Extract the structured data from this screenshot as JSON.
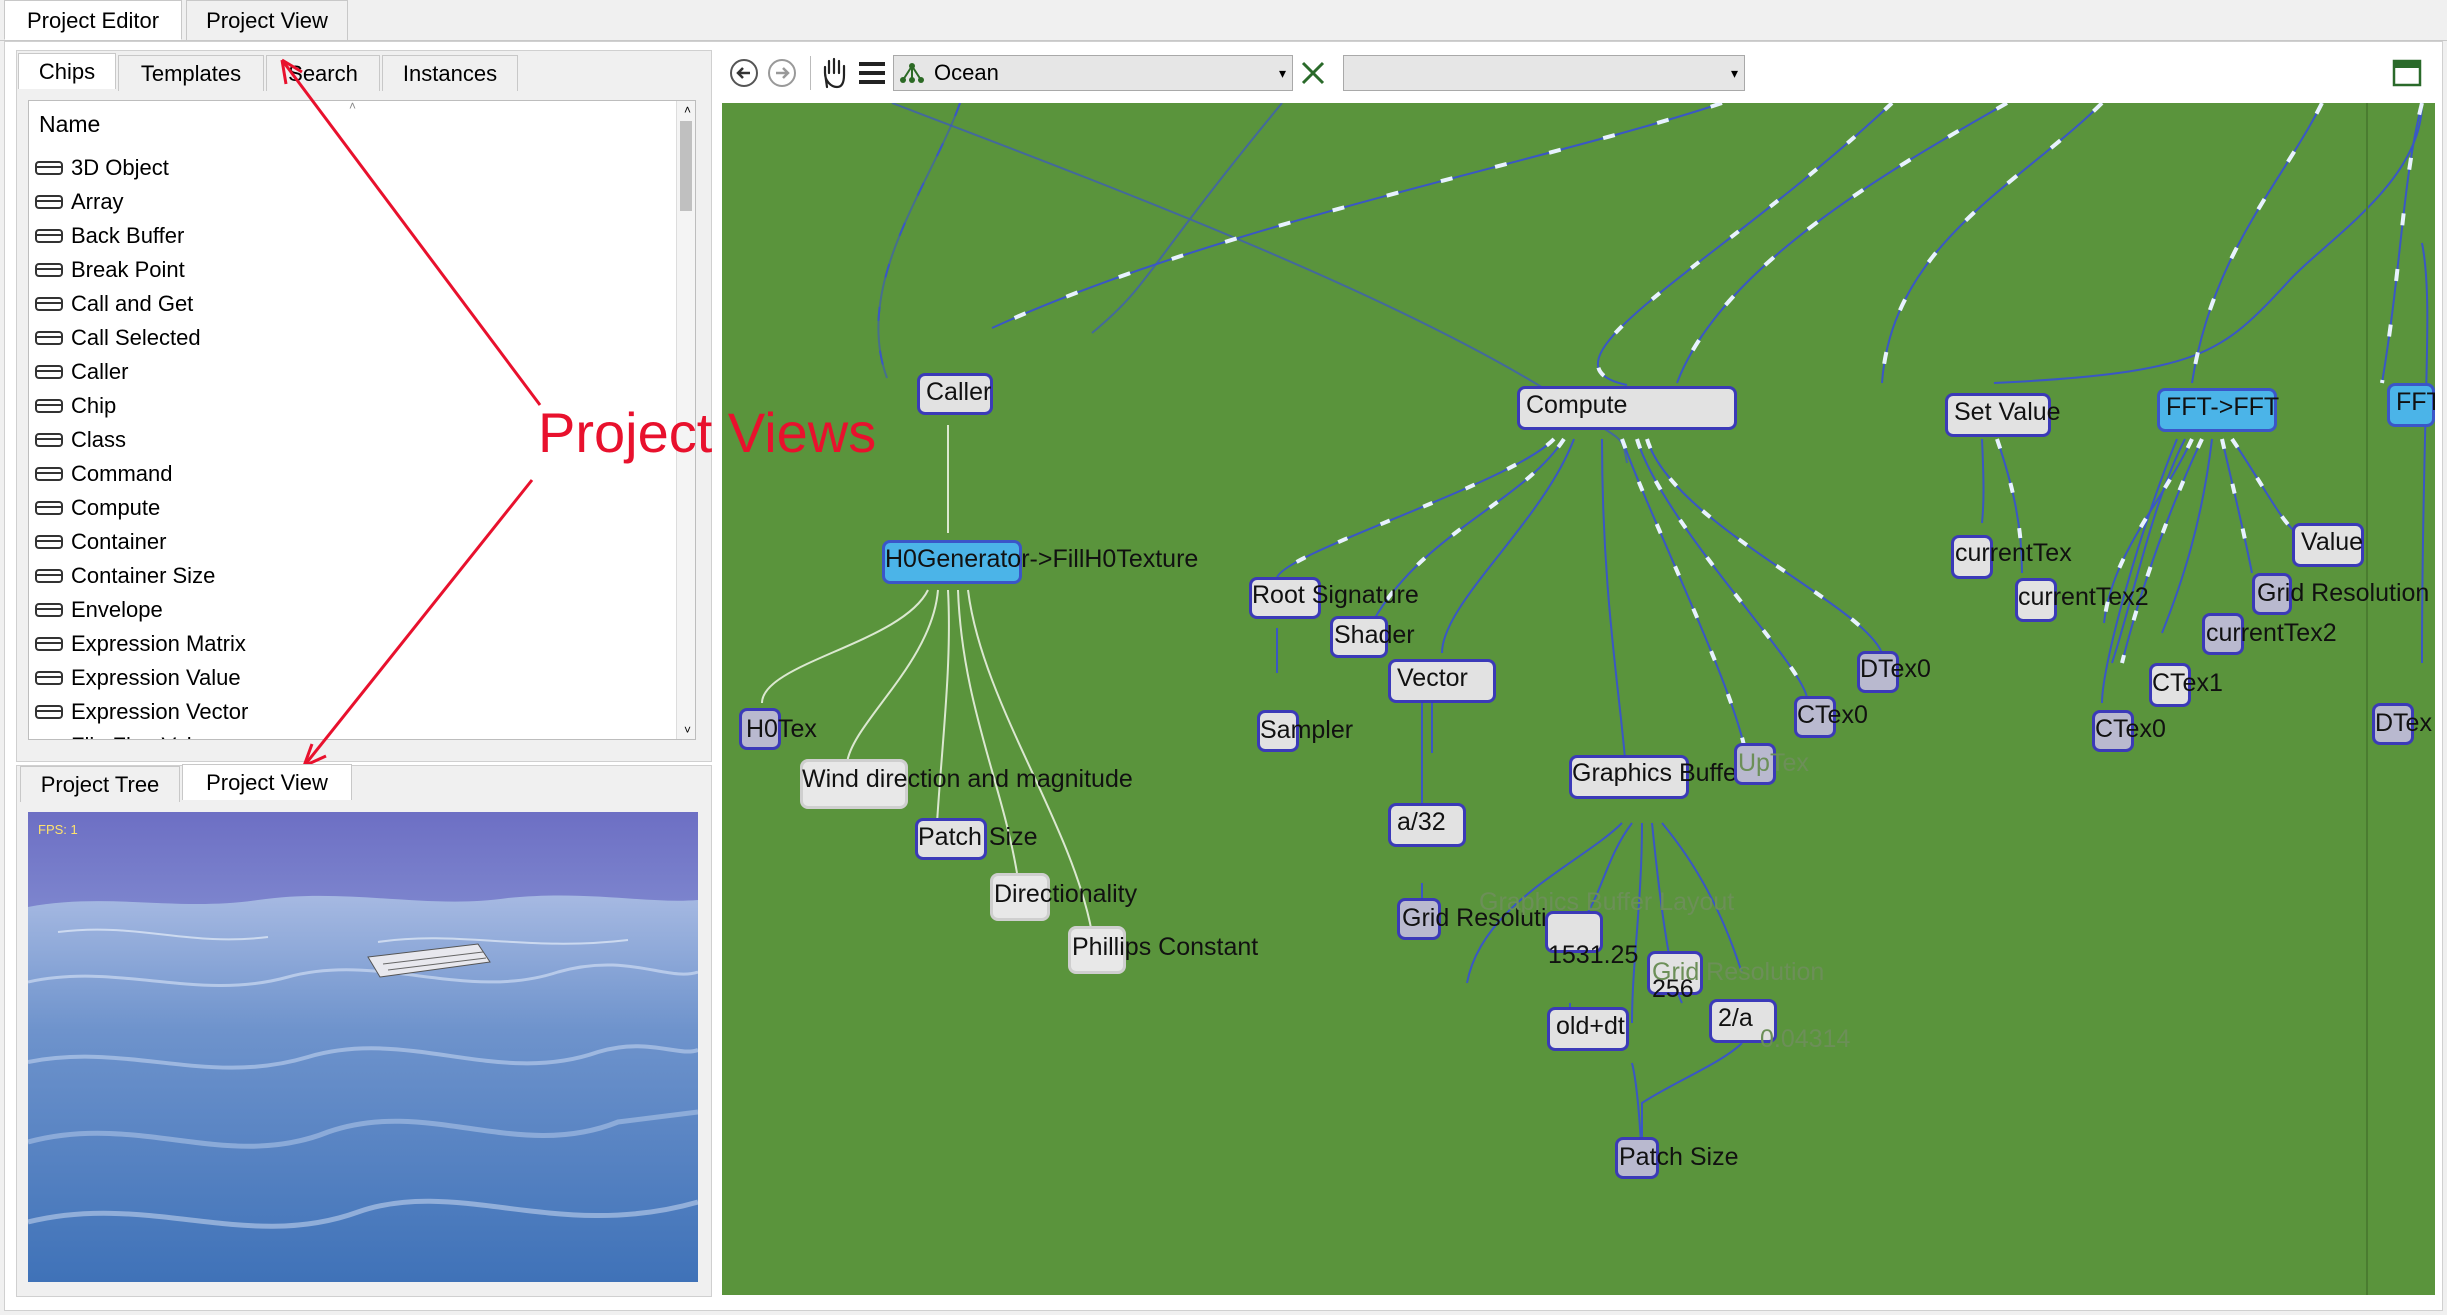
{
  "top_tabs": [
    "Project Editor",
    "Project View"
  ],
  "left_tabs": [
    "Chips",
    "Templates",
    "Search",
    "Instances"
  ],
  "list_header": "Name",
  "chips": [
    "3D Object",
    "Array",
    "Back Buffer",
    "Break Point",
    "Call and Get",
    "Call Selected",
    "Caller",
    "Chip",
    "Class",
    "Command",
    "Compute",
    "Container",
    "Container Size",
    "Envelope",
    "Expression Matrix",
    "Expression Value",
    "Expression Vector",
    "Flip Flop Value"
  ],
  "bottom_tabs": [
    "Project Tree",
    "Project View"
  ],
  "preview": {
    "fps": "FPS: 1"
  },
  "toolbar": {
    "project_combo": "Ocean",
    "second_combo": ""
  },
  "annotation": "Project Views",
  "nodes": {
    "caller": "Caller",
    "h0gen": "H0Generator->FillH0Texture",
    "h0tex": "H0Tex",
    "wind": "Wind direction and magnitude",
    "patch1": "Patch Size",
    "direc": "Directionality",
    "phillips": "Phillips Constant",
    "compute": "Compute",
    "rootsig": "Root Signature",
    "shader": "Shader",
    "sampler": "Sampler",
    "vector": "Vector",
    "a32": "a/32",
    "gridres1": "Grid Resolution",
    "gfxbuf": "Graphics Buffer",
    "gfxbuflayout": "Graphics Buffer Layout",
    "n1531": "1531.25",
    "n256": "256",
    "gridres2": "Grid Resolution",
    "olddt": "old+dt",
    "two_a": "2/a",
    "n314": "0.04314",
    "patch2": "Patch Size",
    "uptex": "UpTex",
    "ctex0a": "CTex0",
    "dtex0a": "DTex0",
    "setvalue": "Set Value",
    "currenttex": "currentTex",
    "currenttex2a": "currentTex2",
    "ffttofft": "FFT->FFT",
    "value": "Value",
    "gridres3": "Grid Resolution",
    "currenttex2b": "currentTex2",
    "ctex1": "CTex1",
    "ctex0b": "CTex0",
    "fft2": "FFT",
    "dtex0b": "DTex"
  },
  "colors": {
    "canvas": "#5a943c",
    "node_border": "#3b3ab8",
    "node_blue": "#4bb4e8",
    "annotation": "#e8112d"
  }
}
